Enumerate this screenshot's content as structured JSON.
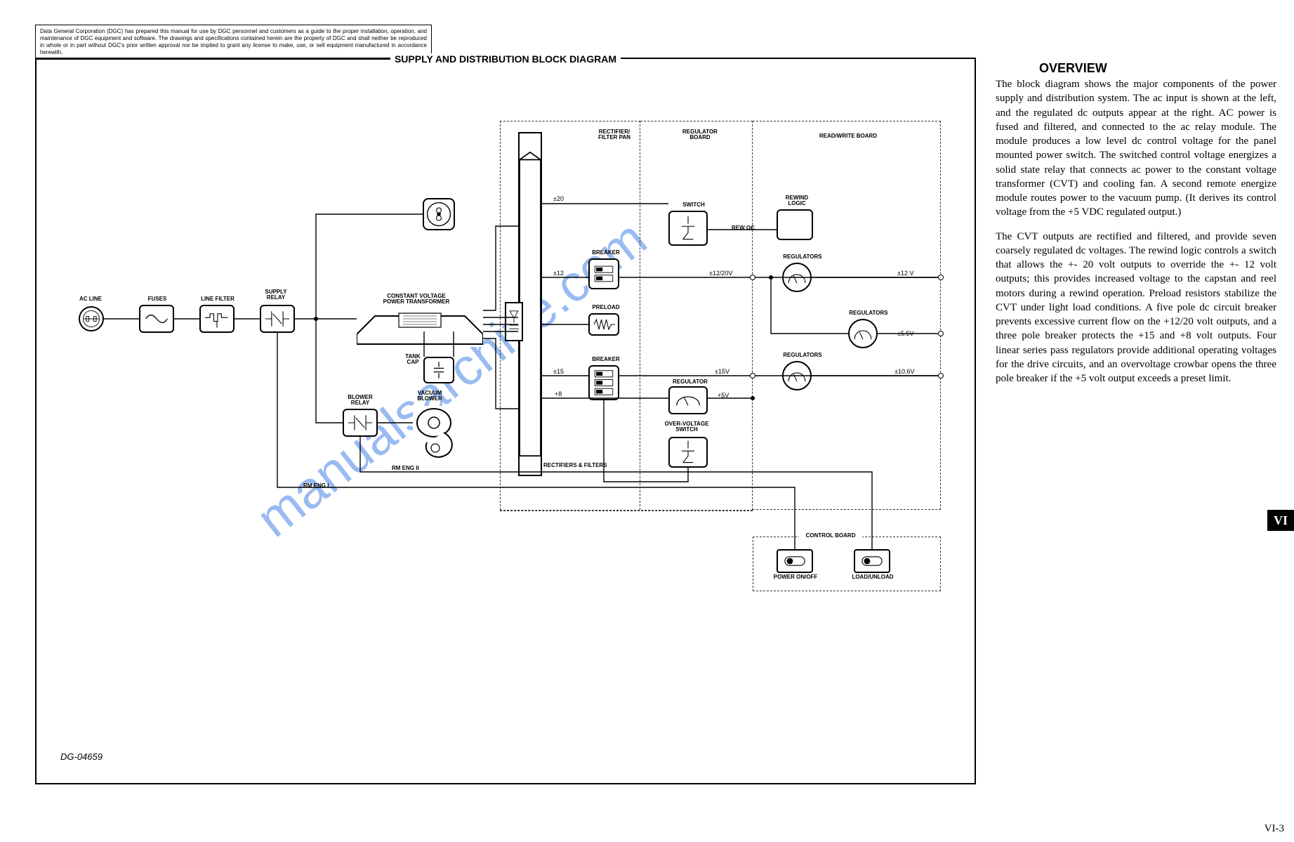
{
  "legal": "Data General Corporation (DGC) has prepared this manual for use by DGC personnel and customers as a guide to the proper installation, operation, and maintenance of DGC equipment and software. The drawings and specifications contained herein are the property of DGC and shall neither be reproduced in whole or in part without DGC's prior written approval nor be implied to grant any license to make, use, or sell equipment manufactured in accordance herewith.",
  "diagram": {
    "title": "SUPPLY AND DISTRIBUTION BLOCK DIAGRAM",
    "docId": "DG-04659",
    "sections": {
      "rectifier": "RECTIFIER/\nFILTER PAN",
      "regulator": "REGULATOR\nBOARD",
      "rw": "READ/WRITE BOARD"
    },
    "blocks": {
      "acLine": "AC LINE",
      "fuses": "FUSES",
      "lineFilter": "LINE FILTER",
      "supplyRelay": "SUPPLY\nRELAY",
      "cvt": "CONSTANT VOLTAGE\nPOWER TRANSFORMER",
      "tankCap": "TANK\nCAP",
      "blowerRelay": "BLOWER\nRELAY",
      "vacuumBlower": "VACUUM\nBLOWER",
      "fan": "FAN",
      "rectFilter": "RECTIFIER/FILTER",
      "breaker1": "BREAKER",
      "breaker2": "BREAKER",
      "preload": "PRELOAD",
      "switch": "SWITCH",
      "regulator": "REGULATOR",
      "ovSwitch": "OVER-VOLTAGE\nSWITCH",
      "rewindLogic": "REWIND\nLOGIC",
      "regulators1": "REGULATORS",
      "regulators2": "REGULATORS",
      "regulators3": "REGULATORS",
      "controlBoard": "CONTROL BOARD",
      "powerOnOff": "POWER ON/OFF",
      "loadUnload": "LOAD/UNLOAD"
    },
    "signals": {
      "p20": "±20",
      "p12": "±12",
      "p15": "±15",
      "p8": "+8",
      "rewOc": "REW OC",
      "p1220v": "±12/20V",
      "p15v": "±15V",
      "p5v": "+5V",
      "out12": "±12 V",
      "out55": "±5.5V",
      "out106": "±10.6V",
      "rmeng1": "RM ENG I",
      "rmeng2": "RM ENG II",
      "rectFilt": "RECTIFIERS & FILTERS"
    }
  },
  "overview": {
    "title": "OVERVIEW",
    "p1": "The block diagram shows the major components of the power supply and distribution system. The ac input is shown at the left, and the regulated dc outputs appear at the right. AC power is fused and filtered, and connected to the ac relay module. The module produces a low level dc control voltage for the panel mounted power switch. The switched control voltage energizes a solid state relay that connects ac power to the constant voltage transformer (CVT) and cooling fan. A second remote energize module routes power to the vacuum pump. (It derives its control voltage from the +5 VDC regulated output.)",
    "p2": "The CVT outputs are rectified and filtered, and provide seven coarsely regulated dc voltages. The rewind logic controls a switch that allows the +- 20 volt outputs to override the +- 12 volt outputs; this provides increased voltage to the capstan and reel motors during a rewind operation. Preload resistors stabilize the CVT under light load conditions. A five pole dc circuit breaker prevents excessive current flow on the +12/20 volt outputs, and a three pole breaker protects the +15 and +8 volt outputs. Four linear series pass regulators provide additional operating voltages for the drive circuits, and an overvoltage crowbar opens the three pole breaker if the +5 volt output exceeds a preset limit."
  },
  "tab": "VI",
  "pageNum": "VI-3",
  "watermark": "manualsarchive.com"
}
